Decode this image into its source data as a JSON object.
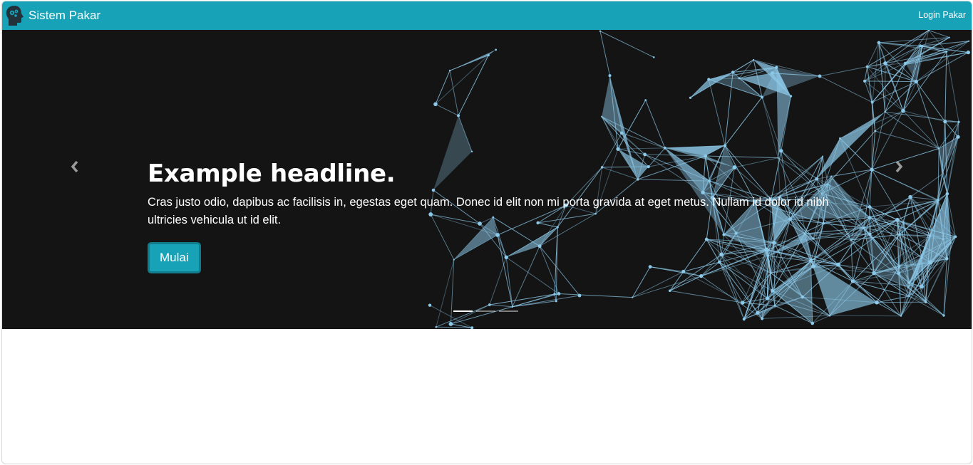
{
  "navbar": {
    "brand_label": "Sistem Pakar",
    "login_label": "Login Pakar",
    "background": "#17a2b8"
  },
  "carousel": {
    "headline": "Example headline.",
    "lead": "Cras justo odio, dapibus ac facilisis in, egestas eget quam. Donec id elit non mi porta gravida at eget metus. Nullam id dolor id nibh ultricies vehicula ut id elit.",
    "button_label": "Mulai",
    "prev_icon": "chevron-left-icon",
    "next_icon": "chevron-right-icon",
    "slide_count": 3,
    "active_slide": 1,
    "background": "#141414",
    "network_color": "#8cc8e8"
  }
}
